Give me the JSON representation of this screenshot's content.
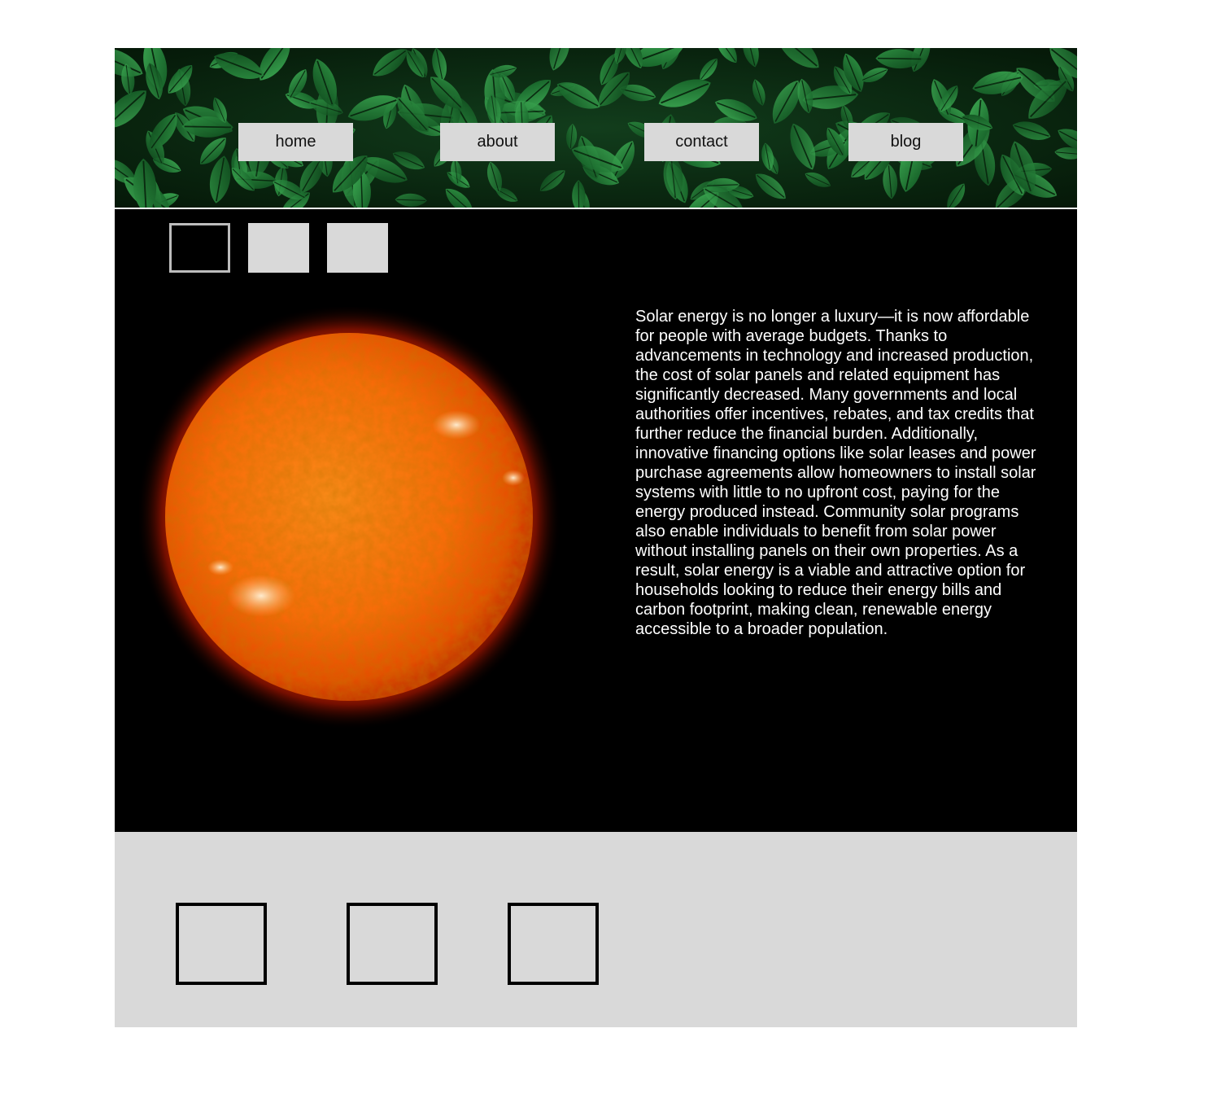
{
  "header": {
    "background_icon": "leaf-pattern-image",
    "nav": [
      {
        "label": "home"
      },
      {
        "label": "about"
      },
      {
        "label": "contact"
      },
      {
        "label": "blog"
      }
    ]
  },
  "main": {
    "image_icon": "sun-image",
    "paragraph": "Solar energy is no longer a luxury—it is now affordable for people with average budgets. Thanks to advancements in technology and increased production, the cost of solar panels and related equipment has significantly decreased. Many governments and local authorities offer incentives, rebates, and tax credits that further reduce the financial burden. Additionally, innovative financing options like solar leases and power purchase agreements allow homeowners to install solar systems with little to no upfront cost, paying for the energy produced instead. Community solar programs also enable individuals to benefit from solar power without installing panels on their own properties. As a result, solar energy is a viable and attractive option for households looking to reduce their energy bills and carbon footprint, making clean, renewable energy accessible to a broader population."
  },
  "colors": {
    "nav_button": "#d9d9d9",
    "main_background": "#000000",
    "footer_background": "#d9d9d9",
    "body_text": "#ffffff"
  }
}
